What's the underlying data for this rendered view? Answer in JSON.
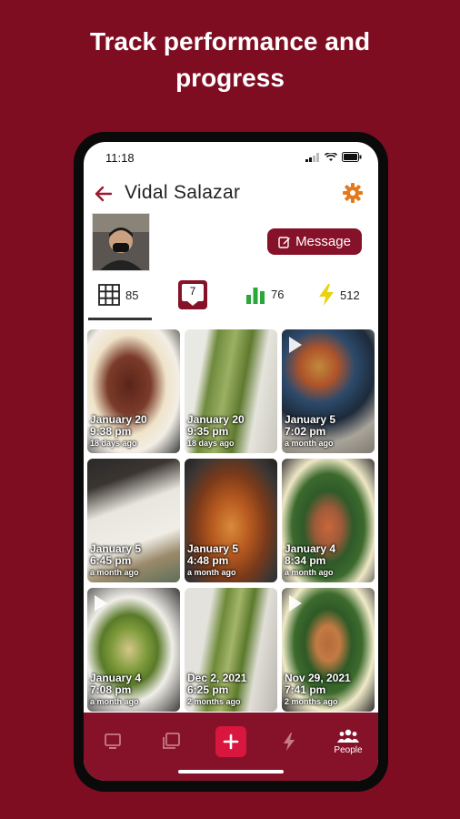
{
  "promo": {
    "headline_line1": "Track performance and",
    "headline_line2": "progress"
  },
  "status_bar": {
    "time": "11:18"
  },
  "profile": {
    "name": "Vidal Salazar",
    "message_button": "Message",
    "stats": {
      "posts": "85",
      "notifications": "7",
      "chart": "76",
      "energy": "512"
    }
  },
  "colors": {
    "brand": "#86122a",
    "background": "#7f0d22",
    "accent_orange": "#e3791b",
    "green": "#2aa63a",
    "yellow": "#e8d211"
  },
  "posts": [
    {
      "date": "January 20",
      "time": "9:38 pm",
      "ago": "18 days ago",
      "video": false
    },
    {
      "date": "January 20",
      "time": "9:35 pm",
      "ago": "18 days ago",
      "video": false
    },
    {
      "date": "January 5",
      "time": "7:02 pm",
      "ago": "a month ago",
      "video": true
    },
    {
      "date": "January 5",
      "time": "6:45 pm",
      "ago": "a month ago",
      "video": false
    },
    {
      "date": "January 5",
      "time": "4:48 pm",
      "ago": "a month ago",
      "video": false
    },
    {
      "date": "January 4",
      "time": "8:34 pm",
      "ago": "a month ago",
      "video": false
    },
    {
      "date": "January 4",
      "time": "7:08 pm",
      "ago": "a month ago",
      "video": true
    },
    {
      "date": "Dec 2, 2021",
      "time": "6:25 pm",
      "ago": "2 months ago",
      "video": false
    },
    {
      "date": "Nov 29, 2021",
      "time": "7:41 pm",
      "ago": "2 months ago",
      "video": true
    }
  ],
  "bottom_nav": {
    "people_label": "People"
  }
}
